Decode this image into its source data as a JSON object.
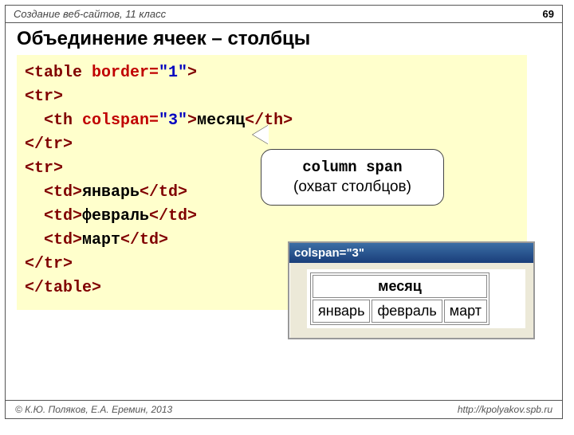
{
  "header": {
    "topic": "Создание веб-сайтов, 11 класс",
    "page": "69"
  },
  "title": "Объединение ячеек – столбцы",
  "code": {
    "l1a": "<table ",
    "l1b": "border=",
    "l1c": "\"1\"",
    "l1d": ">",
    "l2": "<tr>",
    "l3a": "  <th ",
    "l3b": "colspan=",
    "l3c": "\"3\"",
    "l3d": ">",
    "l3e": "месяц",
    "l3f": "</th>",
    "l4": "</tr>",
    "l5": "<tr>",
    "l6a": "  <td>",
    "l6b": "январь",
    "l6c": "</td>",
    "l7a": "  <td>",
    "l7b": "февраль",
    "l7c": "</td>",
    "l8a": "  <td>",
    "l8b": "март",
    "l8c": "</td>",
    "l9": "</tr>",
    "l10": "</table>"
  },
  "callout": {
    "term": "column span",
    "desc": "(охват столбцов)"
  },
  "browser": {
    "title": "colspan=\"3\"",
    "th": "месяц",
    "cells": [
      "январь",
      "февраль",
      "март"
    ]
  },
  "footer": {
    "left": "© К.Ю. Поляков, Е.А. Еремин, 2013",
    "right": "http://kpolyakov.spb.ru"
  }
}
